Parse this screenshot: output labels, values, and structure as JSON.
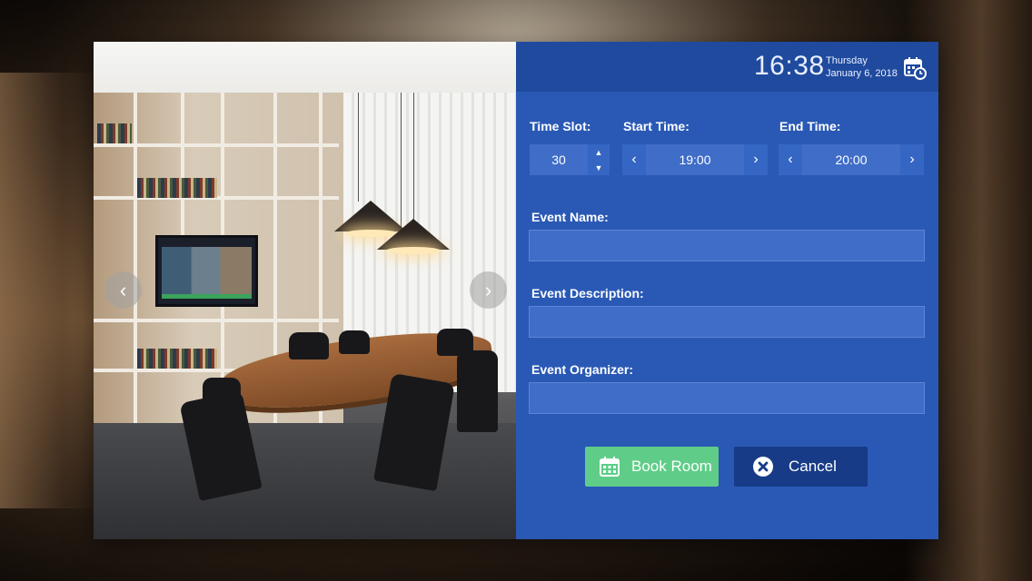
{
  "header": {
    "time": "16:38",
    "weekday": "Thursday",
    "date": "January 6, 2018",
    "calendar_icon": "calendar-clock-icon"
  },
  "gallery": {
    "prev_icon": "chevron-left-icon",
    "next_icon": "chevron-right-icon",
    "prev_glyph": "‹",
    "next_glyph": "›"
  },
  "form": {
    "time_slot": {
      "label": "Time Slot:",
      "value": "30",
      "up_glyph": "▲",
      "down_glyph": "▼"
    },
    "start_time": {
      "label": "Start Time:",
      "value": "19:00",
      "prev_glyph": "‹",
      "next_glyph": "›"
    },
    "end_time": {
      "label": "End Time:",
      "value": "20:00",
      "prev_glyph": "‹",
      "next_glyph": "›"
    },
    "event_name": {
      "label": "Event Name:",
      "value": ""
    },
    "event_description": {
      "label": "Event Description:",
      "value": ""
    },
    "event_organizer": {
      "label": "Event Organizer:",
      "value": ""
    }
  },
  "actions": {
    "book_label": "Book Room",
    "book_icon": "calendar-icon",
    "cancel_label": "Cancel",
    "cancel_icon": "close-circle-icon"
  },
  "colors": {
    "panel_blue": "#2a59b5",
    "header_blue": "#1f4a9e",
    "book_green": "#5fcd88",
    "cancel_navy": "#173b86"
  }
}
